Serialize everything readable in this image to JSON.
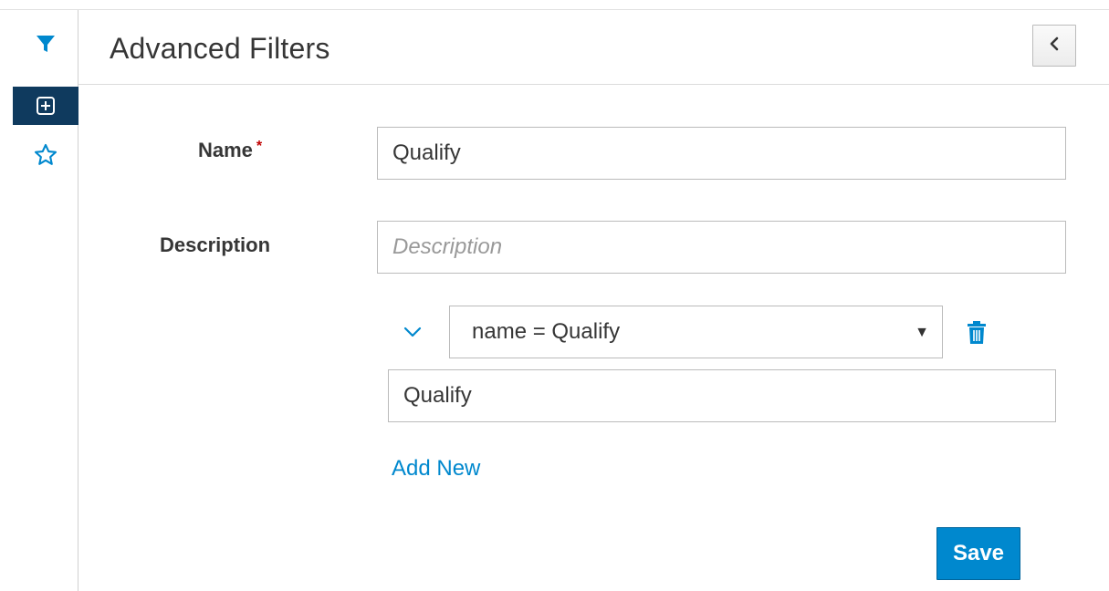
{
  "sidebar": {
    "items": [
      {
        "icon": "filter-icon",
        "active": false
      },
      {
        "icon": "add-icon",
        "active": true
      },
      {
        "icon": "star-icon",
        "active": false
      }
    ]
  },
  "header": {
    "title": "Advanced Filters",
    "collapse_icon": "chevron-left-icon"
  },
  "form": {
    "name": {
      "label": "Name",
      "required_mark": "*",
      "value": "Qualify"
    },
    "description": {
      "label": "Description",
      "value": "",
      "placeholder": "Description"
    },
    "condition": {
      "selected": "name = Qualify",
      "value": "Qualify"
    },
    "add_new_label": "Add New",
    "save_label": "Save"
  },
  "colors": {
    "accent": "#0088ce",
    "sidebar_active": "#0f3a5e",
    "required": "#c00000"
  }
}
